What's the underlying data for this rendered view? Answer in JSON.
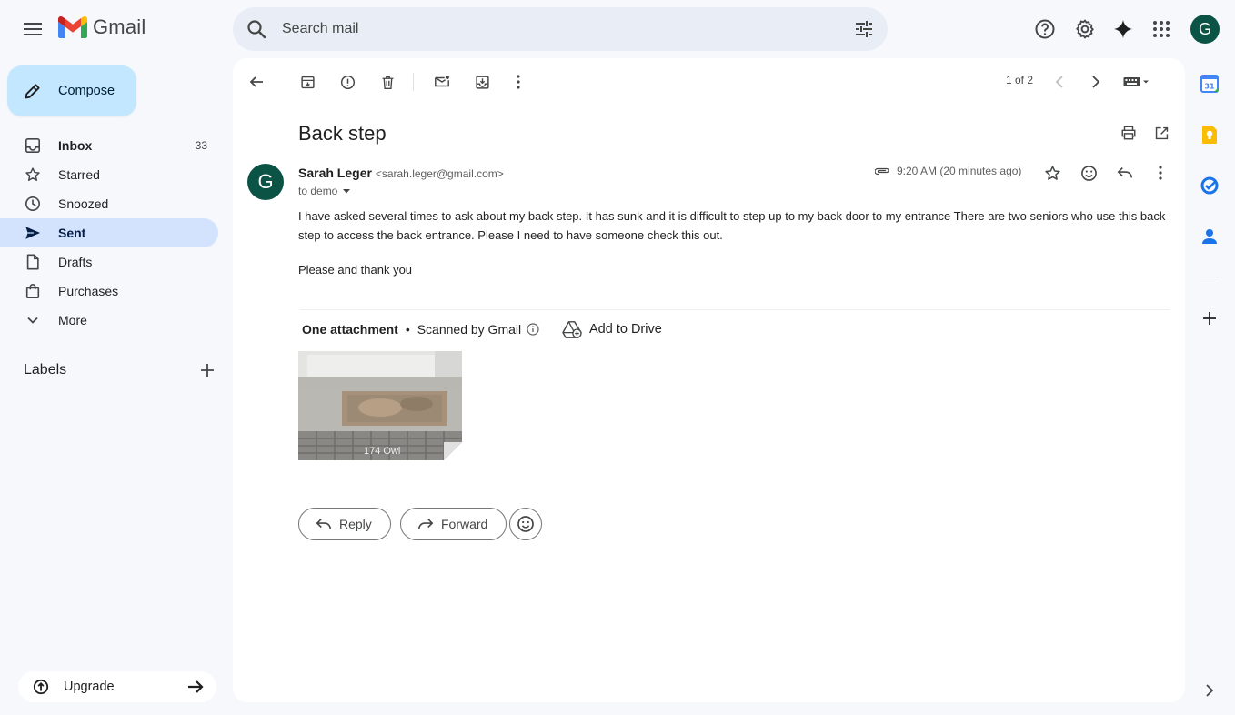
{
  "app": {
    "name": "Gmail"
  },
  "search": {
    "placeholder": "Search mail"
  },
  "compose": {
    "label": "Compose"
  },
  "nav": {
    "items": [
      {
        "label": "Inbox",
        "count": "33"
      },
      {
        "label": "Starred"
      },
      {
        "label": "Snoozed"
      },
      {
        "label": "Sent"
      },
      {
        "label": "Drafts"
      },
      {
        "label": "Purchases"
      },
      {
        "label": "More"
      }
    ],
    "labels_title": "Labels",
    "upgrade": "Upgrade"
  },
  "toolbar": {
    "pager": "1 of 2"
  },
  "email": {
    "subject": "Back step",
    "sender_name": "Sarah Leger",
    "sender_email": "<sarah.leger@gmail.com>",
    "to": "to demo",
    "time": "9:20 AM (20 minutes ago)",
    "body": [
      "I have asked several times to ask about my back step. It has sunk and it is difficult to step up to my back door to my entrance  There are two seniors who use this back step to access the back entrance. Please I need to have someone check this out.",
      "Please and thank you"
    ],
    "attachment": {
      "title": "One attachment",
      "separator": "•",
      "scanned": "Scanned by Gmail",
      "add_to_drive": "Add to Drive",
      "thumb_caption": "174 Owl"
    },
    "reply_label": "Reply",
    "forward_label": "Forward"
  },
  "avatar_letter": "G",
  "colors": {
    "avatar": "#0b5345",
    "compose_bg": "#c2e7ff",
    "active_nav": "#d3e3fd"
  }
}
